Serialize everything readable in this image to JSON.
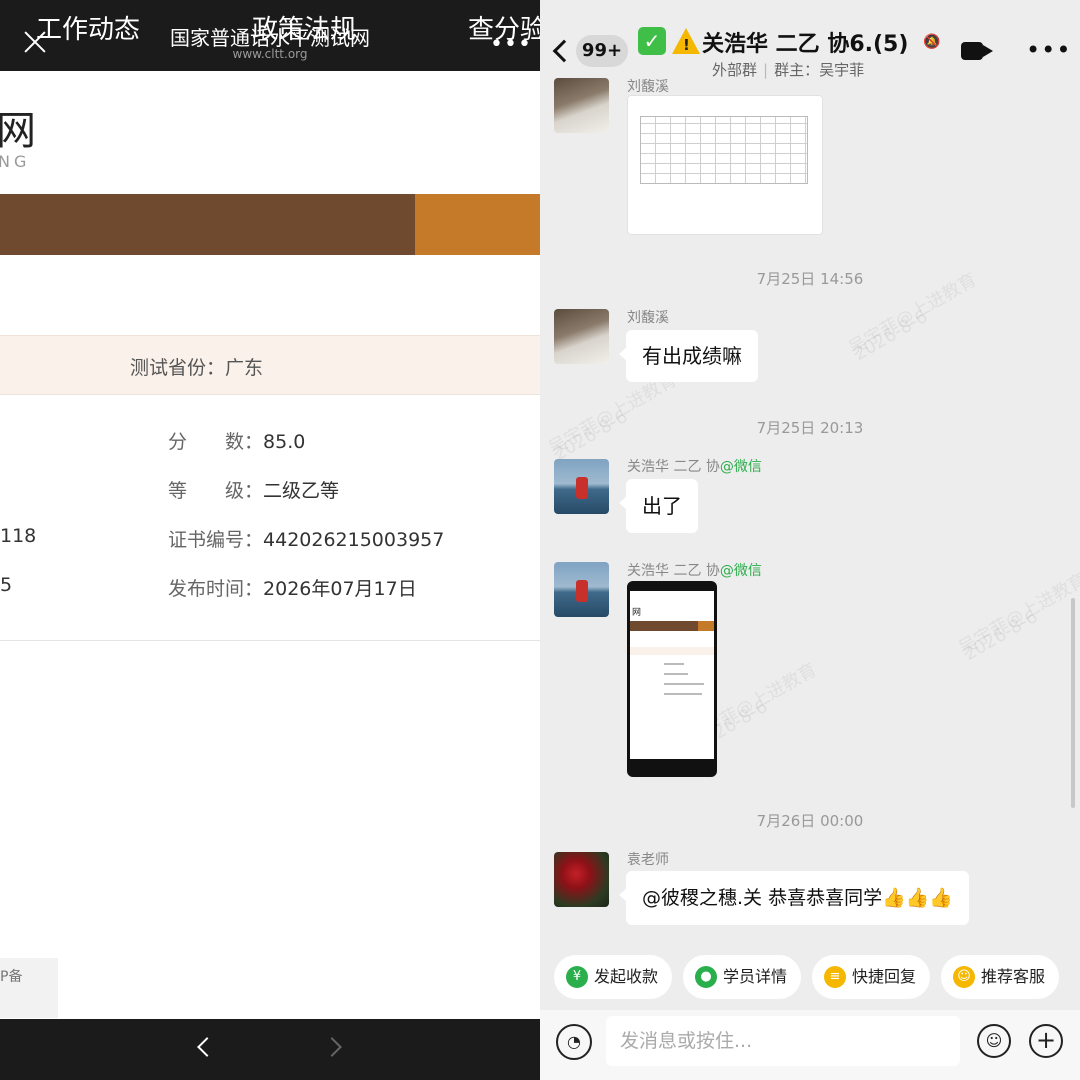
{
  "left": {
    "title": "国家普通话水平测试网",
    "url": "www.cltt.org",
    "menu_glyph": "•••",
    "logo_char": "网",
    "logo_sub": "NG",
    "nav": [
      "工作动态",
      "政策法规",
      "查分验"
    ],
    "province_label": "测试省份：",
    "province_value": "广东",
    "score_label": "分　　数：",
    "score_value": "85.0",
    "level_label": "等　　级：",
    "level_value": "二级乙等",
    "cert_label": "证书编号：",
    "cert_value": "442026215003957",
    "date_label": "发布时间：",
    "date_value": "2026年07月17日",
    "left_frag_1": "118",
    "left_frag_2": "5",
    "icp": "P备"
  },
  "right": {
    "unread_badge": "99+",
    "title": "关浩华 二乙 协6.(5)",
    "tag": "外部群",
    "owner": "群主：吴宇菲",
    "menu_glyph": "•••",
    "messages": [
      {
        "sender": "刘馥溪",
        "type": "image-table"
      },
      {
        "time": "7月25日 14:56"
      },
      {
        "sender": "刘馥溪",
        "text": "有出成绩嘛"
      },
      {
        "time": "7月25日 20:13"
      },
      {
        "sender": "关浩华 二乙 协",
        "source": "@微信",
        "text": "出了"
      },
      {
        "sender": "关浩华 二乙 协",
        "source": "@微信",
        "type": "image-screenshot",
        "thumb_logo": "网"
      },
      {
        "time": "7月26日 00:00"
      },
      {
        "sender": "袁老师",
        "text": "@彼稷之穗.关 恭喜恭喜同学👍👍👍"
      }
    ],
    "watermark": [
      "吴宇菲@上进教育",
      "2026-8-6"
    ],
    "quick_replies": [
      {
        "label": "发起收款",
        "icon": "yen-icon",
        "glyph": "¥",
        "color": "#2bae4c"
      },
      {
        "label": "学员详情",
        "icon": "user-icon",
        "glyph": "●",
        "color": "#2bae4c"
      },
      {
        "label": "快捷回复",
        "icon": "chat-icon",
        "glyph": "≡",
        "color": "#f5b700"
      },
      {
        "label": "推荐客服",
        "icon": "smile-icon",
        "glyph": "☺",
        "color": "#f5b700"
      }
    ],
    "input_placeholder": "发消息或按住..."
  },
  "colors": {
    "nav_brown": "#6f4a2f",
    "nav_active": "#c57a2a",
    "wechat_green": "#2bae4c"
  }
}
